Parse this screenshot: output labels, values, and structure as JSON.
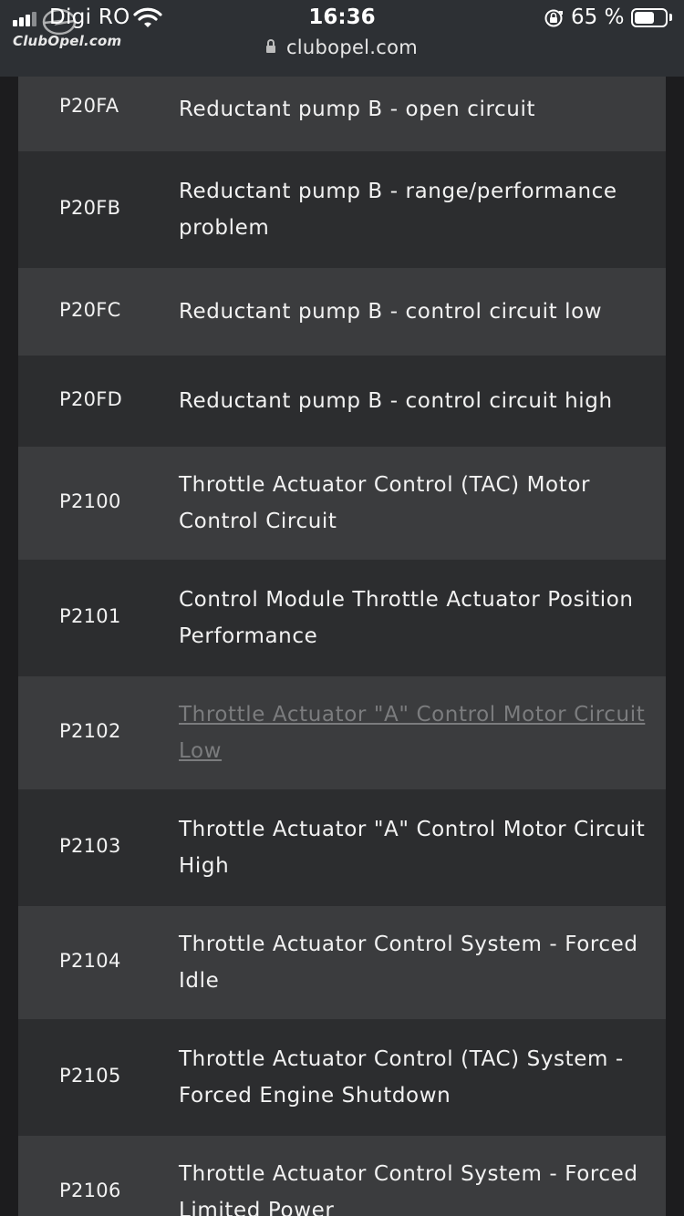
{
  "status_bar": {
    "carrier": "Digi RO",
    "time": "16:36",
    "battery_percent_label": "65 %",
    "battery_level": 0.65,
    "signal_bars": 3,
    "icons": [
      "signal-bars-icon",
      "wifi-icon",
      "orientation-lock-icon",
      "battery-icon"
    ]
  },
  "logo": {
    "text": "ClubOpel.com"
  },
  "address_bar": {
    "url": "clubopel.com",
    "icon": "padlock-icon"
  },
  "colors": {
    "row_light": "#3b3c3e",
    "row_dark": "#2c2d2f",
    "text": "#f2f2f2",
    "link_faded": "#7b7c7e",
    "page_background": "#1c1c1e",
    "status_bar": "#2d3034"
  },
  "dtc_table": {
    "rows": [
      {
        "code": "P20FA",
        "description": "Reductant pump B - open circuit"
      },
      {
        "code": "P20FB",
        "description": "Reductant pump B - range/performance problem"
      },
      {
        "code": "P20FC",
        "description": "Reductant pump B - control circuit low"
      },
      {
        "code": "P20FD",
        "description": "Reductant pump B - control circuit high"
      },
      {
        "code": "P2100",
        "description": "Throttle Actuator Control (TAC) Motor Control Circuit"
      },
      {
        "code": "P2101",
        "description": "Control Module Throttle Actuator Position Performance"
      },
      {
        "code": "P2102",
        "description": "Throttle Actuator \"A\" Control Motor Circuit Low",
        "is_link": true
      },
      {
        "code": "P2103",
        "description": "Throttle Actuator \"A\" Control Motor Circuit High"
      },
      {
        "code": "P2104",
        "description": "Throttle Actuator Control System - Forced Idle"
      },
      {
        "code": "P2105",
        "description": "Throttle Actuator Control (TAC) System - Forced Engine Shutdown"
      },
      {
        "code": "P2106",
        "description": "Throttle Actuator Control System - Forced Limited Power"
      }
    ]
  }
}
